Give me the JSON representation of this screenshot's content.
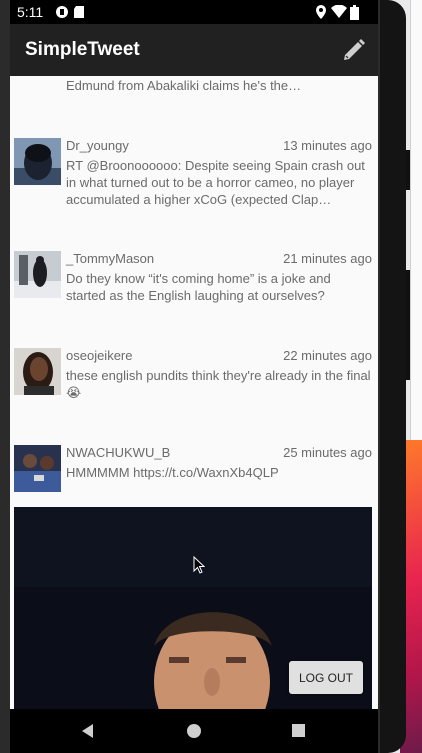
{
  "status_bar": {
    "time": "5:11",
    "icons": [
      "notification-icon",
      "sd-card-icon",
      "location-icon",
      "wifi-icon",
      "battery-icon"
    ]
  },
  "app_bar": {
    "title": "SimpleTweet",
    "compose_icon": "pencil-icon"
  },
  "timeline": {
    "partial_tweet_text": "Edmund from Abakaliki claims he's the…",
    "tweets": [
      {
        "handle": "Dr_youngy",
        "time": "13 minutes ago",
        "text": "RT @Broonoooooo: Despite seeing Spain crash out in what turned out to be a horror cameo, no player accumulated a higher xCoG (expected Clap…",
        "avatar": "avatar-image"
      },
      {
        "handle": "_TommyMason",
        "time": "21 minutes ago",
        "text": "Do they know “it's coming home” is a joke and started as the English laughing at ourselves?",
        "avatar": "avatar-image"
      },
      {
        "handle": "oseojeikere",
        "time": "22 minutes ago",
        "text": "these english pundits think they're already in the final 😭",
        "avatar": "avatar-image"
      },
      {
        "handle": "NWACHUKWU_B",
        "time": "25 minutes ago",
        "text": "HMMMMM https://t.co/WaxnXb4QLP",
        "avatar": "avatar-image"
      }
    ],
    "media": "tweet-image"
  },
  "logout_button": {
    "label": "LOG OUT"
  },
  "nav_bar": {
    "buttons": [
      "back-icon",
      "home-icon",
      "recents-icon"
    ]
  },
  "colors": {
    "app_bar": "#212121",
    "background": "#fafafa",
    "text": "#6b6b6b"
  }
}
